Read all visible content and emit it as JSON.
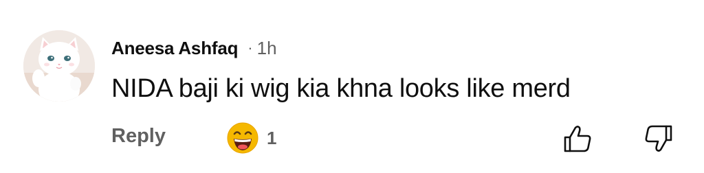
{
  "comment": {
    "author": "Aneesa Ashfaq",
    "separator": "·",
    "time": "1h",
    "text": "NIDA baji ki wig kia khna looks like merd",
    "avatar_icon": "white-kitten-avatar"
  },
  "actions": {
    "reply_label": "Reply",
    "reaction_icon": "grinning-face-emoji",
    "reaction_count": "1",
    "like_icon": "thumbs-up-icon",
    "dislike_icon": "thumbs-down-icon"
  },
  "colors": {
    "primary_text": "#0f0f0f",
    "secondary_text": "#606060",
    "emoji_yellow": "#f5b800"
  }
}
